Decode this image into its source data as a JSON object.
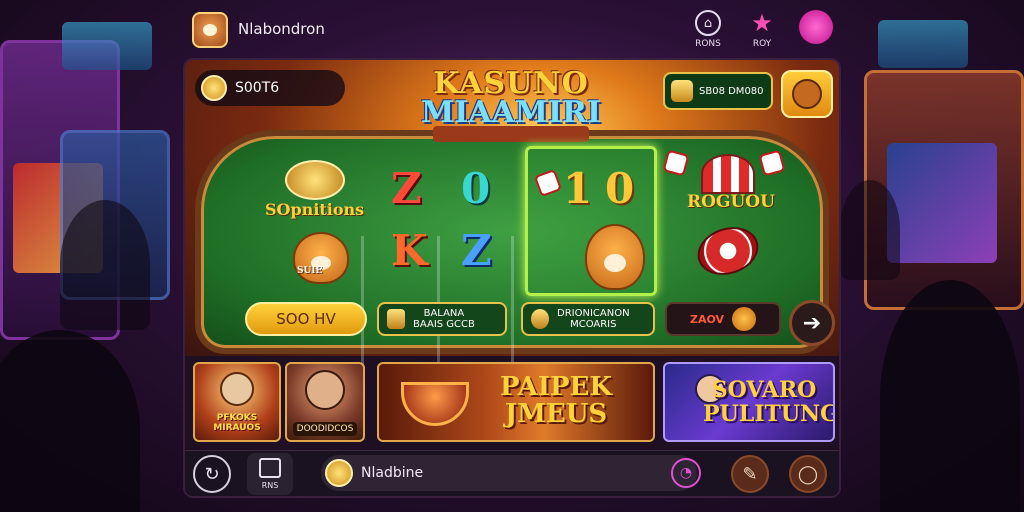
{
  "app": {
    "brand_name": "Nlabondron",
    "top_icons": [
      {
        "name": "home",
        "label": "RONS"
      },
      {
        "name": "star",
        "label": "ROY"
      },
      {
        "name": "profile",
        "label": ""
      }
    ]
  },
  "hero": {
    "balance": "S00T6",
    "title_line1": "KASUNO",
    "title_line2": "MIAAMIRI",
    "promo_label": "SB08 DM080",
    "left_label": "SOpnitions",
    "pile_label": "SUIE",
    "reels": [
      "Z",
      "0",
      "1",
      "0",
      "K",
      "Z"
    ],
    "right_label": "ROGUOU"
  },
  "actions": {
    "gold_button": "SOO HV",
    "green1_line1": "BALANA",
    "green1_line2": "BAAIS GCCB",
    "green2_line1": "DRIONICANON",
    "green2_line2": "MCOARIS",
    "red_label": "ZAOV"
  },
  "cards": [
    {
      "title": "PFKOKS MIRAUOS"
    },
    {
      "title": "DOODIDCOS"
    },
    {
      "title": "PAIPEK JMEUS"
    },
    {
      "title": "SOVARO PULITUNG"
    }
  ],
  "bottombar": {
    "grid_label": "RNS",
    "search_value": "Nladbine"
  },
  "colors": {
    "table_green": "#2f8a34",
    "gold": "#ffd23a",
    "accent_pink": "#ff4fb5"
  }
}
